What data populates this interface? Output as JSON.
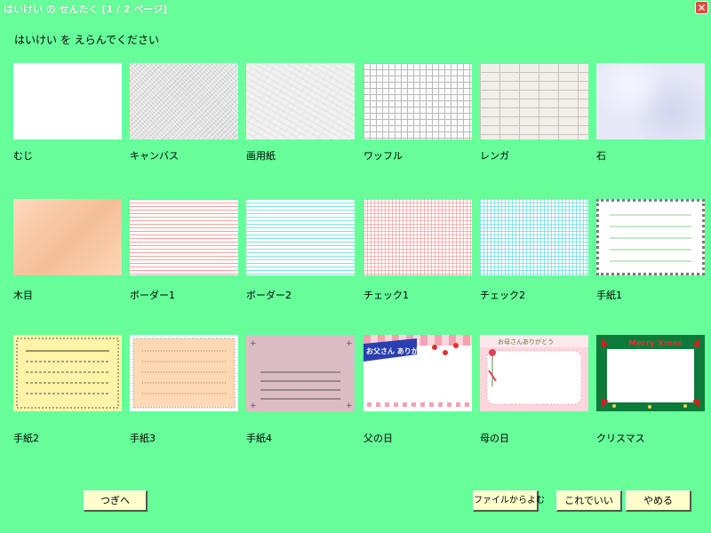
{
  "window": {
    "title": "はいけい の せんたく [1 / 2 ページ]",
    "close_glyph": "✕"
  },
  "instruction": "はいけい を えらんでください",
  "backgrounds": [
    {
      "label": "むじ"
    },
    {
      "label": "キャンバス"
    },
    {
      "label": "画用紙"
    },
    {
      "label": "ワッフル"
    },
    {
      "label": "レンガ"
    },
    {
      "label": "石"
    },
    {
      "label": "木目"
    },
    {
      "label": "ボーダー1"
    },
    {
      "label": "ボーダー2"
    },
    {
      "label": "チェック1"
    },
    {
      "label": "チェック2"
    },
    {
      "label": "手紙1"
    },
    {
      "label": "手紙2"
    },
    {
      "label": "手紙3"
    },
    {
      "label": "手紙4"
    },
    {
      "label": "父の日",
      "overlay_text": "お父さん ありがとう!"
    },
    {
      "label": "母の日",
      "overlay_text": "お母さんありがとう"
    },
    {
      "label": "クリスマス",
      "overlay_text": "Merry Xmas"
    }
  ],
  "buttons": {
    "next": "つぎへ",
    "load_file": "ファイルからよむ",
    "ok": "これでいい",
    "cancel": "やめる"
  }
}
